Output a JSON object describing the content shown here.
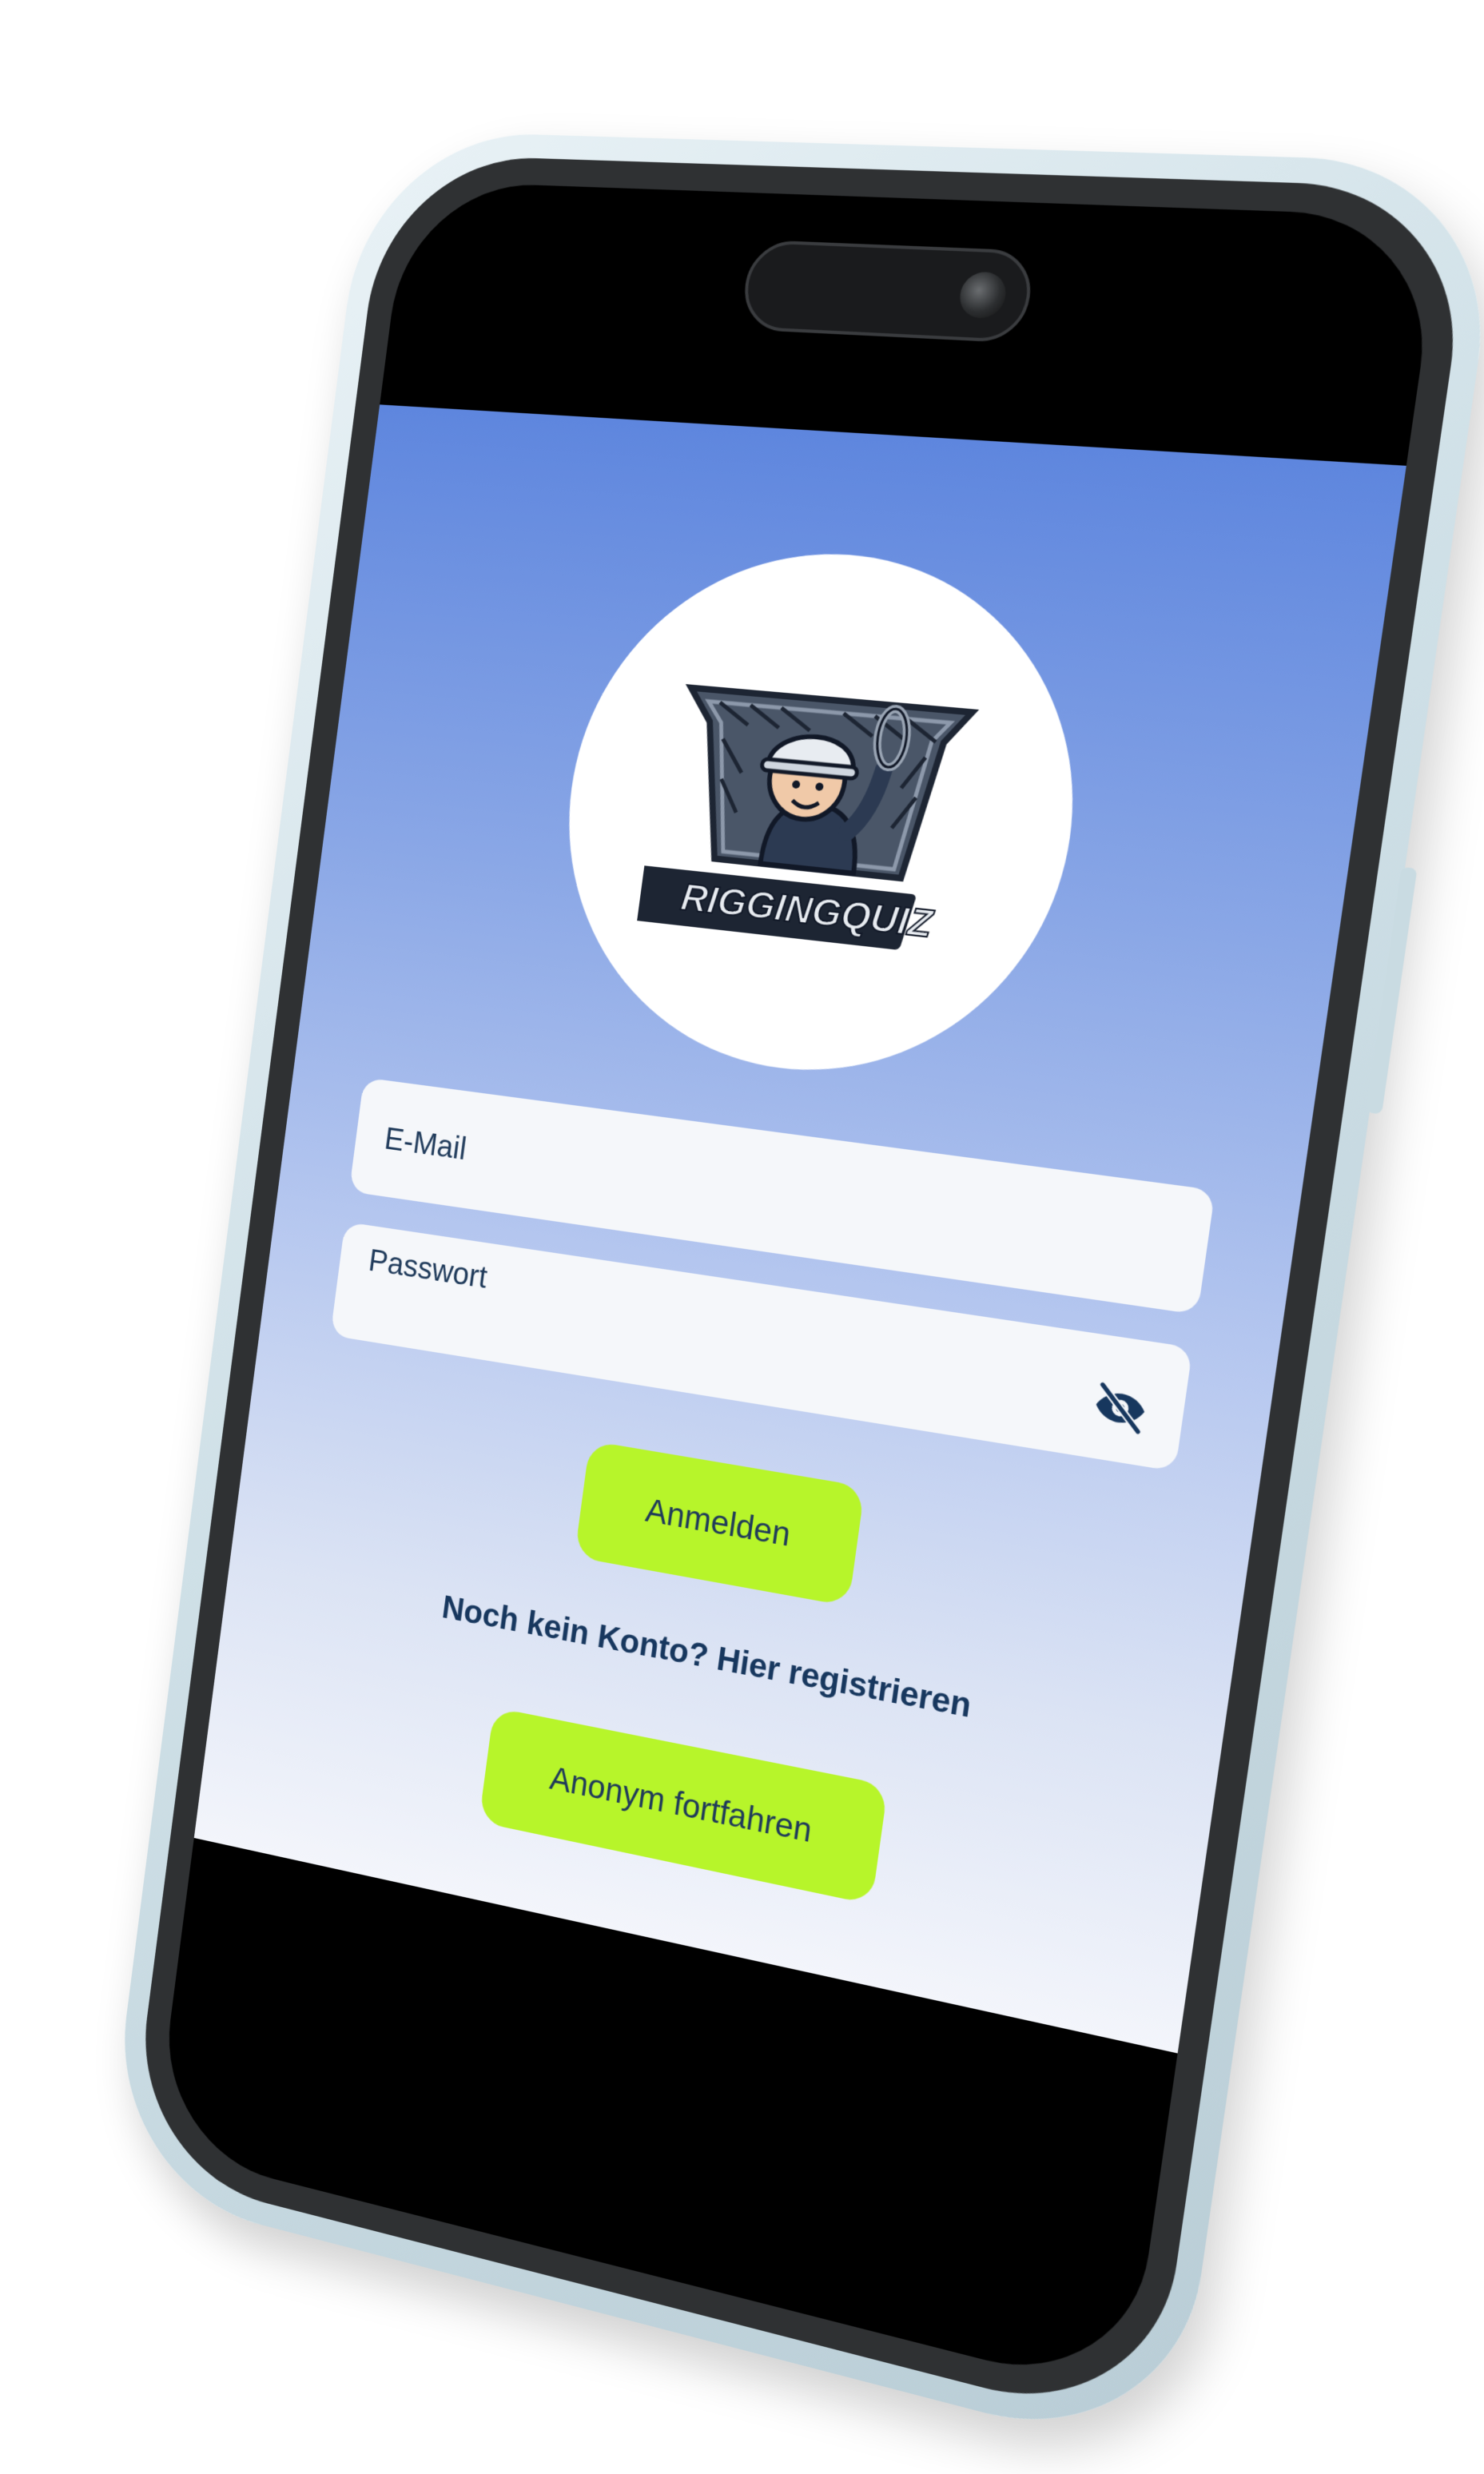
{
  "app": {
    "name": "RiggingQuiz"
  },
  "logo": {
    "text": "RIGGINGQUIZ",
    "icon": "rigging-worker-logo"
  },
  "form": {
    "email_placeholder": "E-Mail",
    "password_placeholder": "Passwort",
    "visibility_icon": "eye-off-icon"
  },
  "actions": {
    "login_label": "Anmelden",
    "register_link": "Noch kein Konto? Hier registrieren",
    "anonymous_label": "Anonym fortfahren"
  },
  "colors": {
    "accent_button": "#b7f52a",
    "text_primary": "#17375e",
    "gradient_top": "#5e86de",
    "gradient_bottom": "#f3f5fb",
    "field_background": "#f5f7fa"
  }
}
